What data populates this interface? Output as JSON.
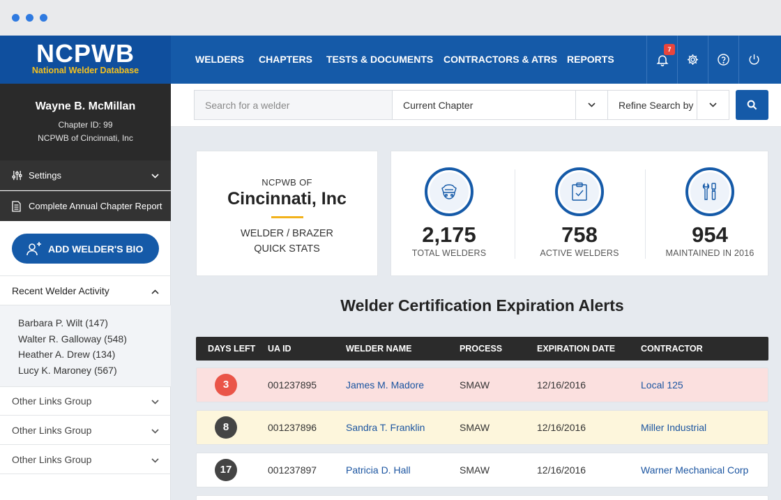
{
  "nav": {
    "logo_main": "NCPWB",
    "logo_sub": "National Welder Database",
    "items": [
      "WELDERS",
      "CHAPTERS",
      "TESTS & DOCUMENTS",
      "CONTRACTORS & ATRS",
      "REPORTS"
    ],
    "notification_count": "7",
    "icons": [
      "bell-icon",
      "gear-icon",
      "help-icon",
      "power-icon"
    ]
  },
  "profile": {
    "name": "Wayne B. McMillan",
    "chapter_id": "Chapter ID: 99",
    "org": "NCPWB of Cincinnati, Inc"
  },
  "sidebar": {
    "settings_label": "Settings",
    "report_label": "Complete Annual Chapter Report",
    "add_button": "ADD WELDER'S BIO",
    "recent_title": "Recent Welder Activity",
    "recent": [
      "Barbara P. Wilt (147)",
      "Walter R. Galloway (548)",
      "Heather A. Drew (134)",
      "Lucy K. Maroney (567)"
    ],
    "other_groups": [
      "Other Links Group",
      "Other Links Group",
      "Other Links Group"
    ]
  },
  "search": {
    "placeholder": "Search for a welder",
    "chapter_select": "Current Chapter",
    "refine_select": "Refine Search by"
  },
  "summary": {
    "pre": "NCPWB OF",
    "city": "Cincinnati, Inc",
    "line1": "WELDER / BRAZER",
    "line2": "QUICK STATS"
  },
  "stats": [
    {
      "value": "2,175",
      "label": "TOTAL WELDERS",
      "icon": "welder-mask-icon"
    },
    {
      "value": "758",
      "label": "ACTIVE WELDERS",
      "icon": "clipboard-check-icon"
    },
    {
      "value": "954",
      "label": "MAINTAINED IN 2016",
      "icon": "tools-icon"
    }
  ],
  "alerts": {
    "title": "Welder Certification Expiration Alerts",
    "headers": [
      "DAYS LEFT",
      "UA ID",
      "WELDER NAME",
      "PROCESS",
      "EXPIRATION DATE",
      "CONTRACTOR"
    ],
    "rows": [
      {
        "days": "3",
        "ua_id": "001237895",
        "name": "James M. Madore",
        "process": "SMAW",
        "date": "12/16/2016",
        "contractor": "Local 125"
      },
      {
        "days": "8",
        "ua_id": "001237896",
        "name": "Sandra T. Franklin",
        "process": "SMAW",
        "date": "12/16/2016",
        "contractor": "Miller Industrial"
      },
      {
        "days": "17",
        "ua_id": "001237897",
        "name": "Patricia D. Hall",
        "process": "SMAW",
        "date": "12/16/2016",
        "contractor": "Warner Mechanical Corp"
      }
    ],
    "colors": {
      "urgent_bg": "#fbe0df",
      "urgent_badge": "#ea5548",
      "warn_bg": "#fdf6dc",
      "warn_badge": "#444444",
      "normal_bg": "#ffffff",
      "normal_badge": "#444444"
    }
  },
  "colors": {
    "brand_blue": "#155aa8",
    "accent_yellow": "#f2b21b"
  }
}
